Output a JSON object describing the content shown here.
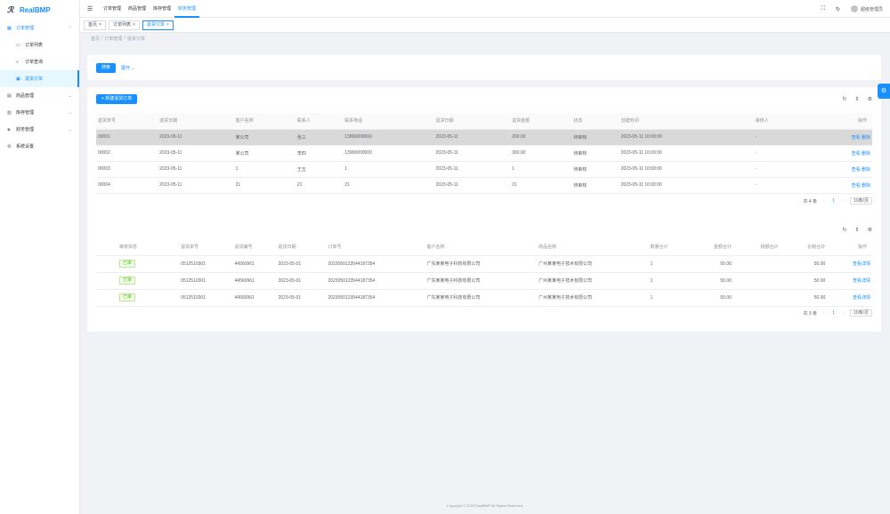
{
  "app": {
    "name": "RealBMP"
  },
  "sidebar": {
    "items": [
      {
        "label": "订单管理",
        "icon": "order-icon",
        "open": true
      },
      {
        "label": "订单列表",
        "icon": "list-icon"
      },
      {
        "label": "订单查询",
        "icon": "search-icon"
      },
      {
        "label": "退货订单",
        "icon": "return-icon",
        "active": true
      },
      {
        "label": "商品管理",
        "icon": "goods-icon"
      },
      {
        "label": "库存管理",
        "icon": "stock-icon"
      },
      {
        "label": "财务管理",
        "icon": "finance-icon"
      },
      {
        "label": "系统设置",
        "icon": "settings-icon"
      }
    ]
  },
  "topnav": {
    "items": [
      "订单管理",
      "商品管理",
      "库存管理",
      "财务管理"
    ]
  },
  "header": {
    "user": "超级管理员"
  },
  "tags": [
    "首页",
    "订单列表",
    "退货订单"
  ],
  "breadcrumb": [
    "首页",
    "/",
    "订单管理",
    "/",
    "退货订单"
  ],
  "search": {
    "query_label": "搜索",
    "expand_label": "展开"
  },
  "toolbar": {
    "add_label": "+ 新建退货订单"
  },
  "table1": {
    "columns": [
      "退货单号",
      "退货日期",
      "客户名称",
      "联系人",
      "联系电话",
      "退货日期",
      "退货金额",
      "状态",
      "创建时间",
      "审核人",
      "操作"
    ],
    "rows": [
      [
        "00001",
        "2023-05-11",
        "某公司",
        "张三",
        "13800000000",
        "2023-05-11",
        "200.00",
        "待审核",
        "2023-05-11 10:00:00",
        "-",
        "查看 删除"
      ],
      [
        "00002",
        "2023-05-11",
        "某公司",
        "李四",
        "13900000000",
        "2023-05-11",
        "300.00",
        "待审核",
        "2023-05-11 10:00:00",
        "-",
        "查看 删除"
      ],
      [
        "00003",
        "2023-05-11",
        "1",
        "王五",
        "1",
        "2023-05-11",
        "1",
        "待审核",
        "2023-05-11 10:00:00",
        "-",
        "查看 删除"
      ],
      [
        "00004",
        "2023-05-11",
        "21",
        "21",
        "21",
        "2023-05-11",
        "21",
        "待审核",
        "2023-05-11 10:00:00",
        "-",
        "查看 删除"
      ]
    ],
    "pager": {
      "total": "共 4 条",
      "page": "1",
      "size": "10条/页"
    }
  },
  "table2": {
    "columns": [
      "审核状态",
      "退货单号",
      "退货编号",
      "退货日期",
      "订单号",
      "客户名称",
      "商品名称",
      "数量合计",
      "金额合计",
      "税额合计",
      "价税合计",
      "操作"
    ],
    "rows": [
      [
        "已审",
        "0512510301",
        "44560961",
        "2023-05-01",
        "2023050123544187354",
        "广东某某电子科技有限公司",
        "广州某某电子技术有限公司",
        "1",
        "50.00",
        "",
        "50.00",
        "查看详情"
      ],
      [
        "已审",
        "0512510301",
        "44560961",
        "2023-05-01",
        "2023050123544187354",
        "广东某某电子科技有限公司",
        "广州某某电子技术有限公司",
        "1",
        "50.00",
        "",
        "50.00",
        "查看详情"
      ],
      [
        "已审",
        "0512510301",
        "44560961",
        "2023-05-01",
        "2023050123544187354",
        "广东某某电子科技有限公司",
        "广州某某电子技术有限公司",
        "1",
        "50.00",
        "",
        "50.00",
        "查看详情"
      ]
    ],
    "pager": {
      "total": "共 3 条",
      "page": "1",
      "size": "10条/页"
    }
  },
  "footer": {
    "text": "Copyright © 2023 RealBMP All Rights Reserved."
  }
}
